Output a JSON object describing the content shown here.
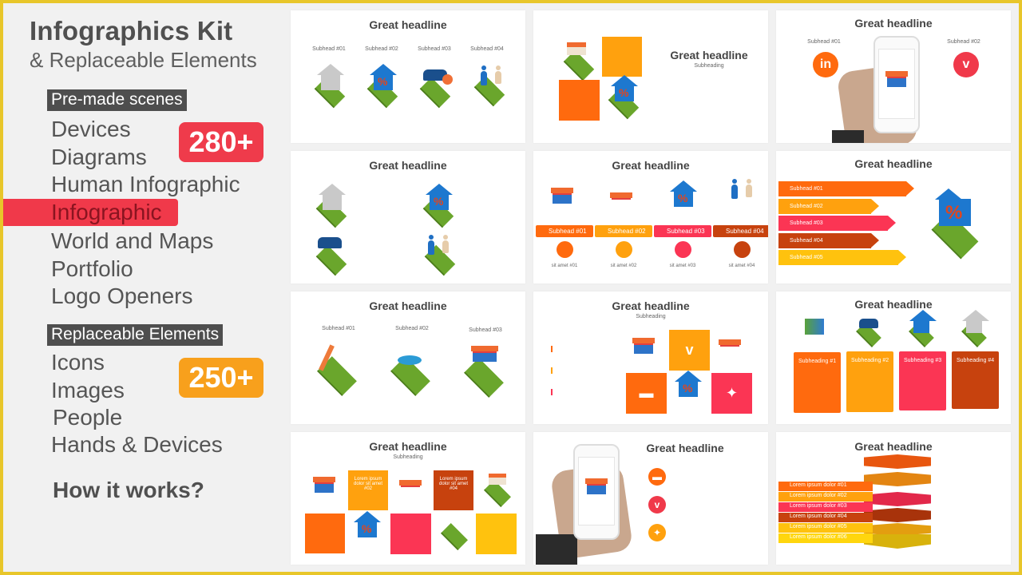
{
  "colors": {
    "border": "#e8c62a",
    "background": "#f1f1f1",
    "text_dark": "#505050",
    "tag_bg": "#4e4e4e",
    "active_red": "#f0394a",
    "badge_red": "#ef3b4b",
    "badge_orange": "#f8a01c",
    "orange": "#ff6a0e",
    "amber": "#ffa10e",
    "pink": "#fb3554",
    "brown": "#c7420e",
    "yellow": "#ffc20e"
  },
  "sidebar": {
    "title": "Infographics Kit",
    "subtitle": "& Replaceable Elements",
    "sections": [
      {
        "tag": "Pre-made scenes",
        "badge": "280+",
        "items": [
          {
            "label": "Devices",
            "active": false
          },
          {
            "label": "Diagrams",
            "active": false
          },
          {
            "label": "Human Infographic",
            "active": false
          },
          {
            "label": "Infographic",
            "active": true
          },
          {
            "label": "World and Maps",
            "active": false
          },
          {
            "label": "Portfolio",
            "active": false
          },
          {
            "label": "Logo Openers",
            "active": false
          }
        ]
      },
      {
        "tag": "Replaceable Elements",
        "badge": "250+",
        "items": [
          {
            "label": "Icons"
          },
          {
            "label": "Images"
          },
          {
            "label": "People"
          },
          {
            "label": "Hands & Devices"
          }
        ]
      }
    ],
    "how_it_works": "How it works?"
  },
  "thumbnails": [
    {
      "headline": "Great headline",
      "subheads": [
        "Subhead #01",
        "Subhead #02",
        "Subhead #03",
        "Subhead #04"
      ]
    },
    {
      "headline": "Great headline",
      "subheading": "Subheading"
    },
    {
      "headline": "Great headline",
      "subheads": [
        "Subhead #01",
        "Subhead #02"
      ]
    },
    {
      "headline": "Great headline"
    },
    {
      "headline": "Great headline",
      "bars": [
        "Subhead #01",
        "Subhead #02",
        "Subhead #03",
        "Subhead #04"
      ],
      "captions": [
        "sit amet #01",
        "sit amet #02",
        "sit amet #03",
        "sit amet #04"
      ]
    },
    {
      "headline": "Great headline",
      "arrows": [
        "Subhead #01",
        "Subhead #02",
        "Subhead #03",
        "Subhead #04",
        "Subhead #05"
      ]
    },
    {
      "headline": "Great headline",
      "subheads": [
        "Subhead #01",
        "Subhead #02",
        "Subhead #03"
      ]
    },
    {
      "headline": "Great headline",
      "subheading": "Subheading"
    },
    {
      "headline": "Great headline",
      "cards": [
        "Subheading #1",
        "Subheading #2",
        "Subheading #3",
        "Subheading #4"
      ]
    },
    {
      "headline": "Great headline",
      "subheading": "Subheading",
      "tile_text": [
        "Lorem ipsum dolor sit amet #02",
        "Lorem ipsum dolor sit amet #04"
      ]
    },
    {
      "headline": "Great headline"
    },
    {
      "headline": "Great headline",
      "layers": [
        "Lorem ipsum dolor #01",
        "Lorem ipsum dolor #02",
        "Lorem ipsum dolor #03",
        "Lorem ipsum dolor #04",
        "Lorem ipsum dolor #05",
        "Lorem ipsum dolor #06"
      ]
    }
  ]
}
